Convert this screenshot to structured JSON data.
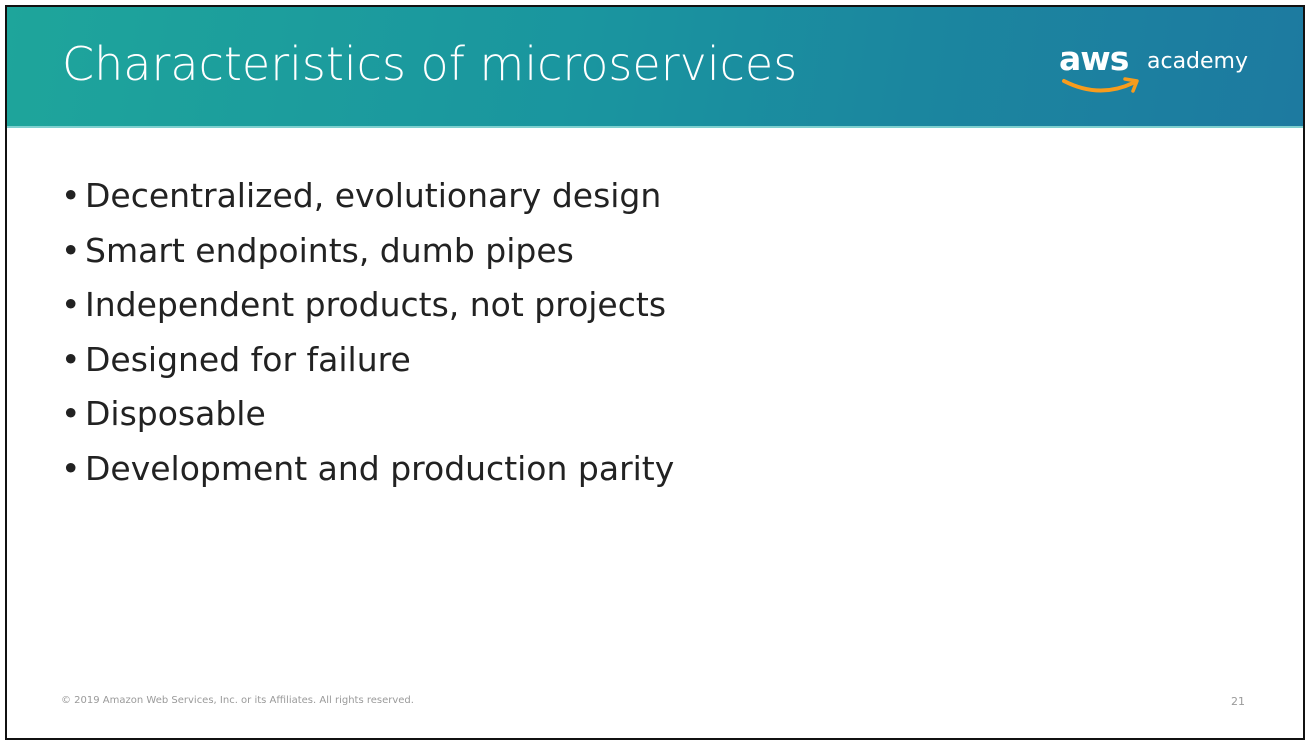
{
  "slide": {
    "title": "Characteristics of microservices",
    "logo": {
      "brand": "aws",
      "product": "academy"
    },
    "bullets": [
      "Decentralized, evolutionary design",
      "Smart endpoints, dumb pipes",
      "Independent products, not projects",
      "Designed for failure",
      "Disposable",
      "Development and production parity"
    ],
    "footer": "© 2019 Amazon Web Services, Inc. or its Affiliates. All rights reserved.",
    "page_number": "21"
  },
  "colors": {
    "header_start": "#1ea59b",
    "header_end": "#1d7aa0",
    "logo_smile": "#f79c1d"
  }
}
